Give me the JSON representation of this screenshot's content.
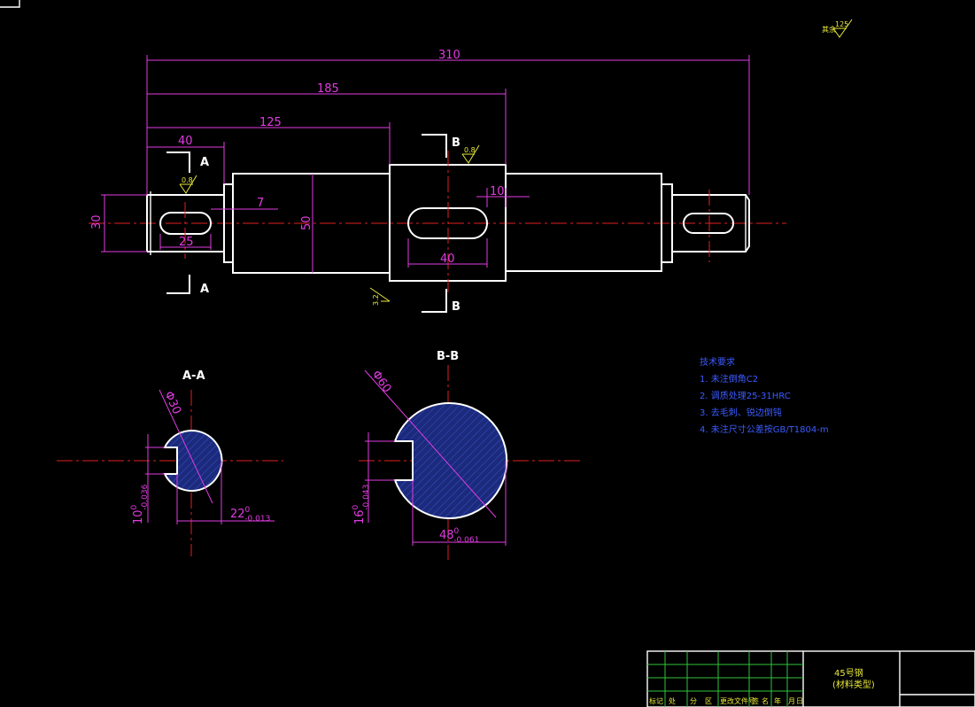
{
  "roughness_global": "125",
  "roughness_labels": [
    "0.8",
    "0.8",
    "3.2"
  ],
  "dimensions": {
    "overall": "310",
    "to_far_shoulder": "185",
    "to_collar": "125",
    "left_journal": "40",
    "slot_offset": "7",
    "key_width_right": "10",
    "left_dia": "30",
    "main_dia": "50",
    "left_slot_len": "25",
    "collar_slot_len": "40",
    "aa_dia": "Φ30",
    "bb_dia": "Φ60"
  },
  "section_markers": {
    "a_top": "A",
    "a_bottom": "A",
    "b_top": "B",
    "b_bottom": "B"
  },
  "section_titles": {
    "aa": "A-A",
    "bb": "B-B"
  },
  "tolerances": {
    "aa_key": {
      "base": "10",
      "upper": "0",
      "lower": "-0.036"
    },
    "aa_depth": {
      "base": "22",
      "upper": "0",
      "lower": "-0.013"
    },
    "bb_key": {
      "base": "16",
      "upper": "0",
      "lower": "-0.043"
    },
    "bb_depth": {
      "base": "48",
      "upper": "0",
      "lower": "-0.061"
    }
  },
  "technical_notes": {
    "title": "技术要求",
    "items": [
      "1. 未注倒角C2",
      "2. 调质处理25-31HRC",
      "3. 去毛刺、锐边倒钝",
      "4. 未注尺寸公差按GB/T1804-m"
    ]
  },
  "title_block": {
    "material": "45号钢",
    "material_note": "(材料类型)",
    "header_cells": [
      "标记",
      "处",
      "分",
      "区",
      "更改文件号",
      "签",
      "名",
      "年",
      "月",
      "日"
    ]
  },
  "colors": {
    "outline": "#ffffff",
    "dimension": "#e23be2",
    "centerline": "#e02020",
    "hatch": "#1b2a7a",
    "notes": "#3c5cff",
    "grid": "#2fc43a",
    "roughness": "#e8e83a"
  }
}
